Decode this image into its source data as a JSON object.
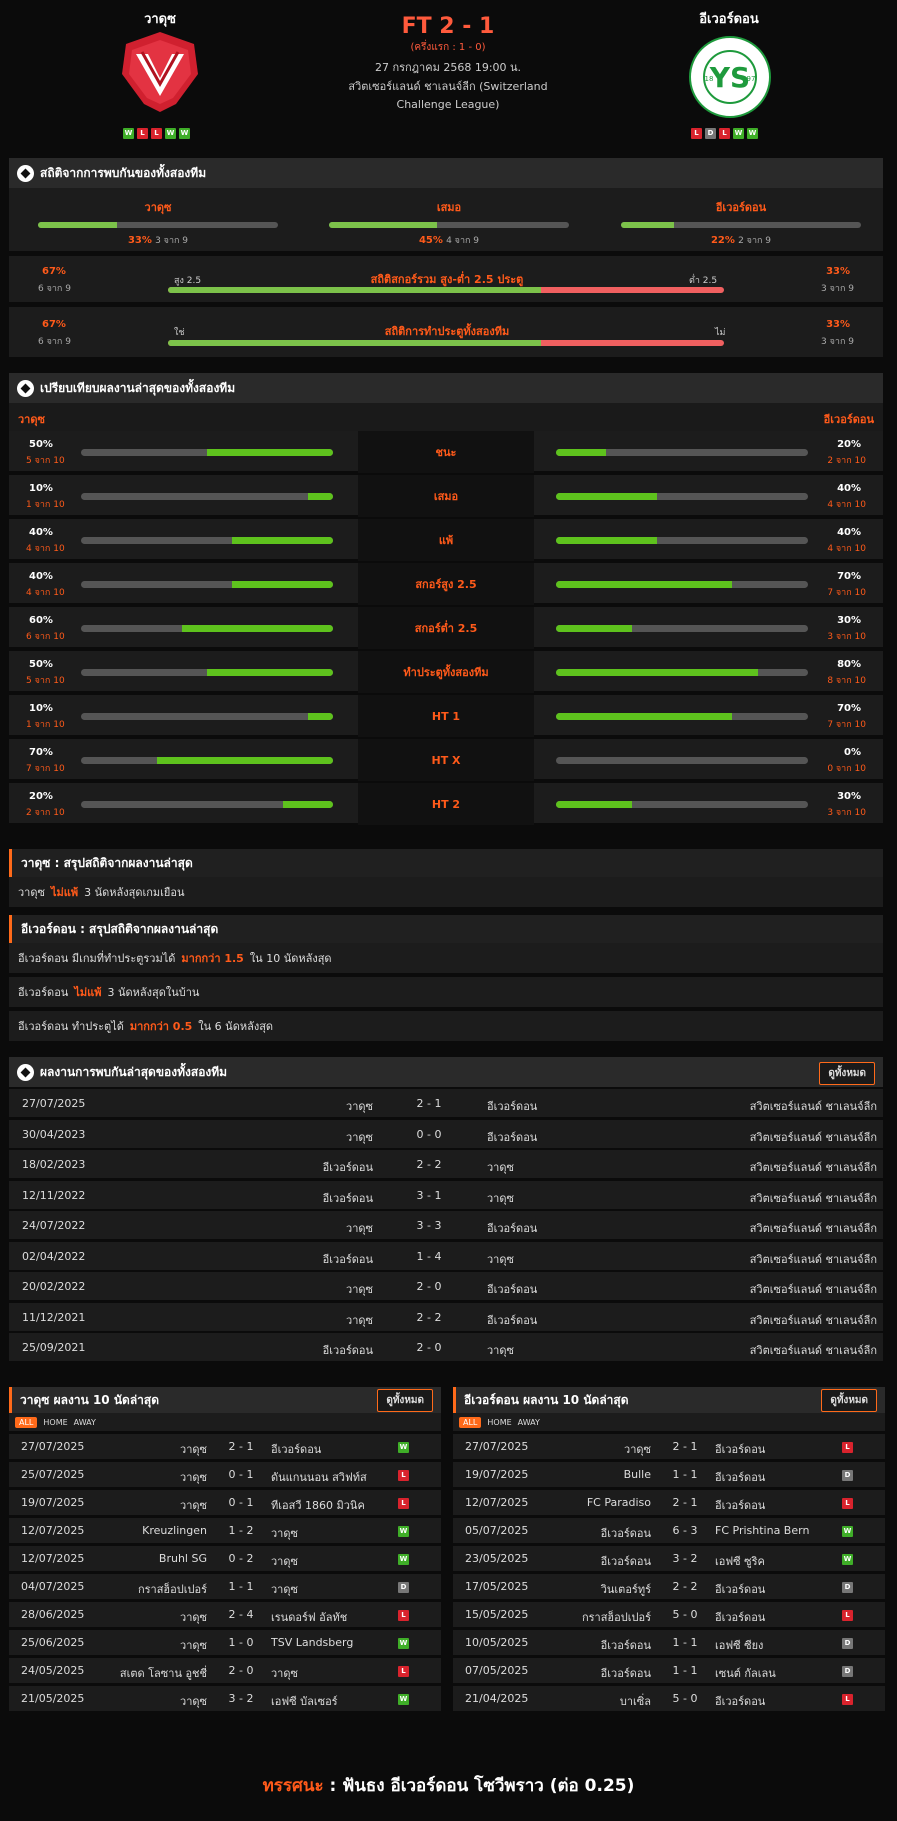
{
  "match": {
    "home": "วาดุซ",
    "away": "อีเวอร์ดอน",
    "score": "FT 2 - 1",
    "ht": "(ครึ่งแรก : 1 - 0)",
    "date": "27 กรกฎาคม 2568 19:00 น.",
    "league1": "สวิตเซอร์แลนด์ ชาเลนจ์ลีก (Switzerland",
    "league2": "Challenge League)",
    "home_form": [
      "W",
      "L",
      "L",
      "W",
      "W"
    ],
    "away_form": [
      "L",
      "D",
      "L",
      "W",
      "W"
    ],
    "away_logo_text": "YVERDON SPORT",
    "away_logo_sub": "FOOTBALL CLUB",
    "away_logo_y1": "18",
    "away_logo_y2": "97"
  },
  "h2h_stats": {
    "title": "สถิติจากการพบกันของทั้งสองทีม",
    "items": [
      {
        "name": "วาดุซ",
        "pct": "33%",
        "count": "3 จาก 9",
        "value": 33
      },
      {
        "name": "เสมอ",
        "pct": "45%",
        "count": "4 จาก 9",
        "value": 45
      },
      {
        "name": "อีเวอร์ดอน",
        "pct": "22%",
        "count": "2 จาก 9",
        "value": 22
      }
    ],
    "ou": {
      "left_pct": "67%",
      "left_count": "6 จาก 9",
      "left_label": "สูง 2.5",
      "title": "สถิติสกอร์รวม สูง-ต่ำ 2.5 ประตู",
      "right_label": "ต่ำ 2.5",
      "right_pct": "33%",
      "right_count": "3 จาก 9",
      "value": 67
    },
    "btts": {
      "left_pct": "67%",
      "left_count": "6 จาก 9",
      "left_label": "ใช่",
      "title": "สถิติการทำประตูทั้งสองทีม",
      "right_label": "ไม่",
      "right_pct": "33%",
      "right_count": "3 จาก 9",
      "value": 67
    }
  },
  "compare": {
    "title": "เปรียบเทียบผลงานล่าสุดของทั้งสองทีม",
    "home": "วาดุซ",
    "away": "อีเวอร์ดอน",
    "rows": [
      {
        "label": "ชนะ",
        "lp": "50%",
        "lc": "5 จาก 10",
        "lv": 50,
        "rp": "20%",
        "rc": "2 จาก 10",
        "rv": 20
      },
      {
        "label": "เสมอ",
        "lp": "10%",
        "lc": "1 จาก 10",
        "lv": 10,
        "rp": "40%",
        "rc": "4 จาก 10",
        "rv": 40
      },
      {
        "label": "แพ้",
        "lp": "40%",
        "lc": "4 จาก 10",
        "lv": 40,
        "rp": "40%",
        "rc": "4 จาก 10",
        "rv": 40
      },
      {
        "label": "สกอร์สูง 2.5",
        "lp": "40%",
        "lc": "4 จาก 10",
        "lv": 40,
        "rp": "70%",
        "rc": "7 จาก 10",
        "rv": 70
      },
      {
        "label": "สกอร์ต่ำ 2.5",
        "lp": "60%",
        "lc": "6 จาก 10",
        "lv": 60,
        "rp": "30%",
        "rc": "3 จาก 10",
        "rv": 30
      },
      {
        "label": "ทำประตูทั้งสองทีม",
        "lp": "50%",
        "lc": "5 จาก 10",
        "lv": 50,
        "rp": "80%",
        "rc": "8 จาก 10",
        "rv": 80
      },
      {
        "label": "HT 1",
        "lp": "10%",
        "lc": "1 จาก 10",
        "lv": 10,
        "rp": "70%",
        "rc": "7 จาก 10",
        "rv": 70
      },
      {
        "label": "HT X",
        "lp": "70%",
        "lc": "7 จาก 10",
        "lv": 70,
        "rp": "0%",
        "rc": "0 จาก 10",
        "rv": 0
      },
      {
        "label": "HT 2",
        "lp": "20%",
        "lc": "2 จาก 10",
        "lv": 20,
        "rp": "30%",
        "rc": "3 จาก 10",
        "rv": 30
      }
    ]
  },
  "summary_home": {
    "title": "วาดุซ : สรุปสถิติจากผลงานล่าสุด",
    "lines": [
      {
        "a": "วาดุซ",
        "b": "ไม่แพ้",
        "c": "3 นัดหลังสุดเกมเยือน"
      }
    ]
  },
  "summary_away": {
    "title": "อีเวอร์ดอน : สรุปสถิติจากผลงานล่าสุด",
    "lines": [
      {
        "a": "อีเวอร์ดอน มีเกมที่ทำประตูรวมได้",
        "b": "มากกว่า 1.5",
        "c": "ใน 10 นัดหลังสุด"
      },
      {
        "a": "อีเวอร์ดอน",
        "b": "ไม่แพ้",
        "c": "3 นัดหลังสุดในบ้าน"
      },
      {
        "a": "อีเวอร์ดอน ทำประตูได้",
        "b": "มากกว่า 0.5",
        "c": "ใน 6 นัดหลังสุด"
      }
    ]
  },
  "h2h": {
    "title": "ผลงานการพบกันล่าสุดของทั้งสองทีม",
    "view_all": "ดูทั้งหมด",
    "rows": [
      [
        "27/07/2025",
        "วาดุซ",
        "2 - 1",
        "อีเวอร์ดอน",
        "สวิตเซอร์แลนด์ ชาเลนจ์ลีก"
      ],
      [
        "30/04/2023",
        "วาดุซ",
        "0 - 0",
        "อีเวอร์ดอน",
        "สวิตเซอร์แลนด์ ชาเลนจ์ลีก"
      ],
      [
        "18/02/2023",
        "อีเวอร์ดอน",
        "2 - 2",
        "วาดุซ",
        "สวิตเซอร์แลนด์ ชาเลนจ์ลีก"
      ],
      [
        "12/11/2022",
        "อีเวอร์ดอน",
        "3 - 1",
        "วาดุซ",
        "สวิตเซอร์แลนด์ ชาเลนจ์ลีก"
      ],
      [
        "24/07/2022",
        "วาดุซ",
        "3 - 3",
        "อีเวอร์ดอน",
        "สวิตเซอร์แลนด์ ชาเลนจ์ลีก"
      ],
      [
        "02/04/2022",
        "อีเวอร์ดอน",
        "1 - 4",
        "วาดุซ",
        "สวิตเซอร์แลนด์ ชาเลนจ์ลีก"
      ],
      [
        "20/02/2022",
        "วาดุซ",
        "2 - 0",
        "อีเวอร์ดอน",
        "สวิตเซอร์แลนด์ ชาเลนจ์ลีก"
      ],
      [
        "11/12/2021",
        "วาดุซ",
        "2 - 2",
        "อีเวอร์ดอน",
        "สวิตเซอร์แลนด์ ชาเลนจ์ลีก"
      ],
      [
        "25/09/2021",
        "อีเวอร์ดอน",
        "2 - 0",
        "วาดุซ",
        "สวิตเซอร์แลนด์ ชาเลนจ์ลีก"
      ]
    ]
  },
  "last10_home": {
    "title": "วาดุซ ผลงาน 10 นัดล่าสุด",
    "view_all": "ดูทั้งหมด",
    "tabs": [
      "ALL",
      "HOME",
      "AWAY"
    ],
    "rows": [
      [
        "27/07/2025",
        "วาดุซ",
        "2 - 1",
        "อีเวอร์ดอน",
        "W"
      ],
      [
        "25/07/2025",
        "วาดุซ",
        "0 - 1",
        "ดันแกนนอน สวิฟท์ส",
        "L"
      ],
      [
        "19/07/2025",
        "วาดุซ",
        "0 - 1",
        "ทีเอสวี 1860 มิวนิค",
        "L"
      ],
      [
        "12/07/2025",
        "Kreuzlingen",
        "1 - 2",
        "วาดุซ",
        "W"
      ],
      [
        "12/07/2025",
        "Bruhl SG",
        "0 - 2",
        "วาดุซ",
        "W"
      ],
      [
        "04/07/2025",
        "กราสฮ็อปเปอร์",
        "1 - 1",
        "วาดุซ",
        "D"
      ],
      [
        "28/06/2025",
        "วาดุซ",
        "2 - 4",
        "เรนดอร์ฟ อัลทัช",
        "L"
      ],
      [
        "25/06/2025",
        "วาดุซ",
        "1 - 0",
        "TSV Landsberg",
        "W"
      ],
      [
        "24/05/2025",
        "สเตด โลซาน อูชชี่",
        "2 - 0",
        "วาดุซ",
        "L"
      ],
      [
        "21/05/2025",
        "วาดุซ",
        "3 - 2",
        "เอฟซี บัลเซอร์",
        "W"
      ]
    ]
  },
  "last10_away": {
    "title": "อีเวอร์ดอน ผลงาน 10 นัดล่าสุด",
    "view_all": "ดูทั้งหมด",
    "tabs": [
      "ALL",
      "HOME",
      "AWAY"
    ],
    "rows": [
      [
        "27/07/2025",
        "วาดุซ",
        "2 - 1",
        "อีเวอร์ดอน",
        "L"
      ],
      [
        "19/07/2025",
        "Bulle",
        "1 - 1",
        "อีเวอร์ดอน",
        "D"
      ],
      [
        "12/07/2025",
        "FC Paradiso",
        "2 - 1",
        "อีเวอร์ดอน",
        "L"
      ],
      [
        "05/07/2025",
        "อีเวอร์ดอน",
        "6 - 3",
        "FC Prishtina Bern",
        "W"
      ],
      [
        "23/05/2025",
        "อีเวอร์ดอน",
        "3 - 2",
        "เอฟซี ซูริค",
        "W"
      ],
      [
        "17/05/2025",
        "วินเตอร์ทูร์",
        "2 - 2",
        "อีเวอร์ดอน",
        "D"
      ],
      [
        "15/05/2025",
        "กราสฮ็อปเปอร์",
        "5 - 0",
        "อีเวอร์ดอน",
        "L"
      ],
      [
        "10/05/2025",
        "อีเวอร์ดอน",
        "1 - 1",
        "เอฟซี ซียง",
        "D"
      ],
      [
        "07/05/2025",
        "อีเวอร์ดอน",
        "1 - 1",
        "เซนต์ กัลเลน",
        "D"
      ],
      [
        "21/04/2025",
        "บาเซิ่ล",
        "5 - 0",
        "อีเวอร์ดอน",
        "L"
      ]
    ]
  },
  "verdict": {
    "label": "ทรรศนะ",
    "sep": " : ",
    "text": "ฟันธง อีเวอร์ดอน โซวีพราว (ต่อ 0.25)"
  },
  "colors": {
    "accent": "#ff5a1a",
    "green": "#5ec21d",
    "red": "#f06060"
  }
}
